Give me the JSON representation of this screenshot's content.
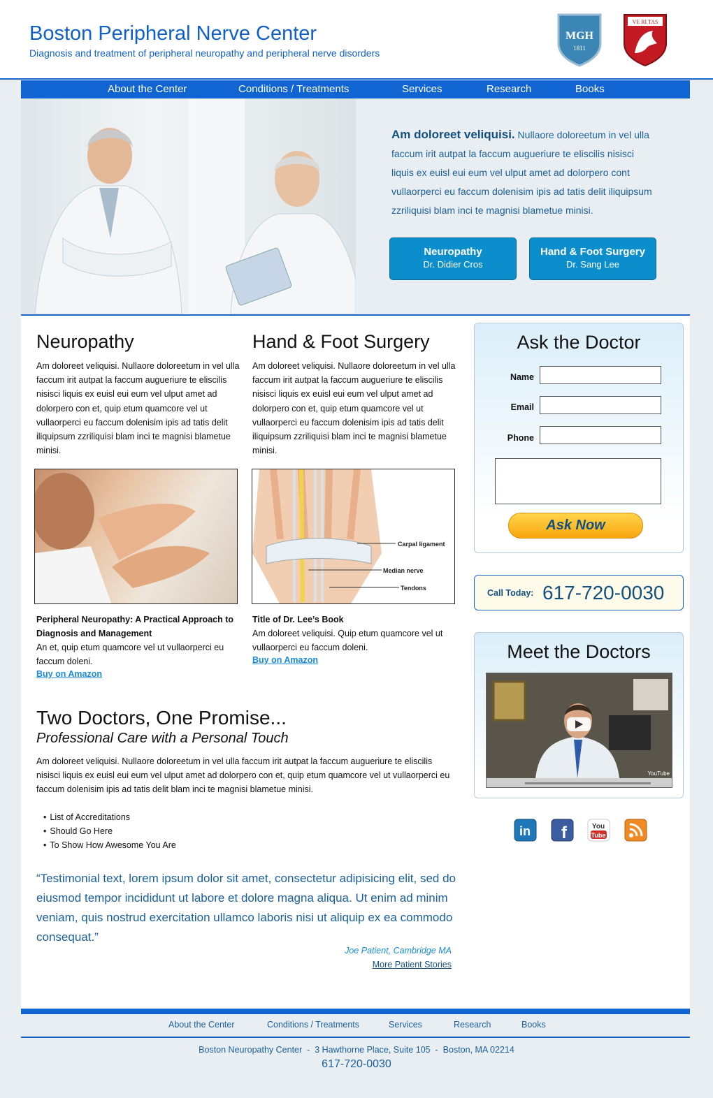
{
  "header": {
    "title": "Boston Peripheral Nerve Center",
    "tagline": "Diagnosis and treatment of peripheral neuropathy and peripheral nerve disorders",
    "logo_mgh": "MGH",
    "logo_mgh_year": "1811",
    "logo_harvard": "VE RI TAS"
  },
  "nav": {
    "items": [
      "About the Center",
      "Conditions / Treatments",
      "Services",
      "Research",
      "Books"
    ]
  },
  "hero": {
    "lead": "Am doloreet veliquisi.",
    "text": " Nullaore doloreetum in vel ulla faccum irit autpat la faccum augueriure te eliscilis nisisci liquis ex euisl eui eum vel ulput amet ad dolorpero cont vullaorperci eu faccum dolenisim ipis ad tatis delit iliquipsum zzriliquisi blam inci te magnisi blametue minisi.",
    "buttons": [
      {
        "title": "Neuropathy",
        "sub": "Dr. Didier Cros"
      },
      {
        "title": "Hand & Foot Surgery",
        "sub": "Dr. Sang Lee"
      }
    ]
  },
  "columns": [
    {
      "title": "Neuropathy",
      "text": "Am doloreet veliquisi. Nullaore doloreetum in vel ulla faccum irit autpat la faccum augueriure te eliscilis nisisci liquis ex euisl eui eum vel ulput amet ad dolorpero con et, quip etum quamcore vel ut vullaorperci eu faccum dolenisim ipis ad tatis delit iliquipsum zzriliquisi blam inci te magnisi blametue minisi.",
      "book_title": "Peripheral Neuropathy: A Practical Approach to Diagnosis and Management",
      "book_desc": "An et, quip etum quamcore vel ut vullaorperci eu faccum doleni.",
      "link": "Buy on Amazon"
    },
    {
      "title": "Hand & Foot Surgery",
      "text": "Am doloreet veliquisi. Nullaore doloreetum in vel ulla faccum irit autpat la faccum augueriure te eliscilis nisisci liquis ex euisl eui eum vel ulput amet ad dolorpero con et, quip etum quamcore vel ut vullaorperci eu faccum dolenisim ipis ad tatis delit iliquipsum zzriliquisi blam inci te magnisi blametue minisi.",
      "book_title": "Title of Dr. Lee’s Book",
      "book_desc": "Am doloreet veliquisi. Quip etum quamcore vel ut vullaorperci eu faccum doleni.",
      "link": "Buy on Amazon",
      "diagram_labels": [
        "Carpal ligament",
        "Median nerve",
        "Tendons"
      ]
    }
  ],
  "promise": {
    "title": "Two Doctors, One Promise...",
    "subtitle": "Professional Care with a Personal Touch",
    "text": "Am doloreet veliquisi. Nullaore doloreetum in vel ulla faccum irit autpat la faccum augueriure te eliscilis nisisci liquis ex euisl eui eum vel ulput amet ad dolorpero con et, quip etum quamcore vel ut vullaorperci eu faccum dolenisim ipis ad tatis delit blam inci te magnisi blametue minisi.",
    "bullets": [
      "List of Accreditations",
      "Should Go Here",
      "To Show How Awesome You Are"
    ]
  },
  "testimonial": {
    "quote": "“Testimonial text, lorem ipsum dolor sit amet, consectetur adipisicing elit, sed do eiusmod tempor incididunt ut labore et dolore magna aliqua. Ut enim ad minim veniam, quis nostrud exercitation ullamco laboris nisi ut aliquip ex ea commodo consequat.”",
    "author": "Joe Patient, Cambridge MA",
    "more": "More Patient Stories"
  },
  "ask": {
    "title": "Ask the Doctor",
    "labels": [
      "Name",
      "Email",
      "Phone"
    ],
    "button": "Ask Now"
  },
  "call": {
    "label": "Call Today:",
    "number": "617-720-0030"
  },
  "meet": {
    "title": "Meet the Doctors",
    "video_brand": "YouTube"
  },
  "social": [
    "linkedin-icon",
    "facebook-icon",
    "youtube-icon",
    "rss-icon"
  ],
  "footer": {
    "nav": [
      "About the Center",
      "Conditions / Treatments",
      "Services",
      "Research",
      "Books"
    ],
    "address": "Boston Neuropathy Center  -  3 Hawthorne Place, Suite 105  -  Boston, MA 02214",
    "phone": "617-720-0030"
  },
  "colors": {
    "brand_blue": "#1065d2",
    "button_blue": "#0b8ecb",
    "ask_gold": "#f7a60e"
  }
}
